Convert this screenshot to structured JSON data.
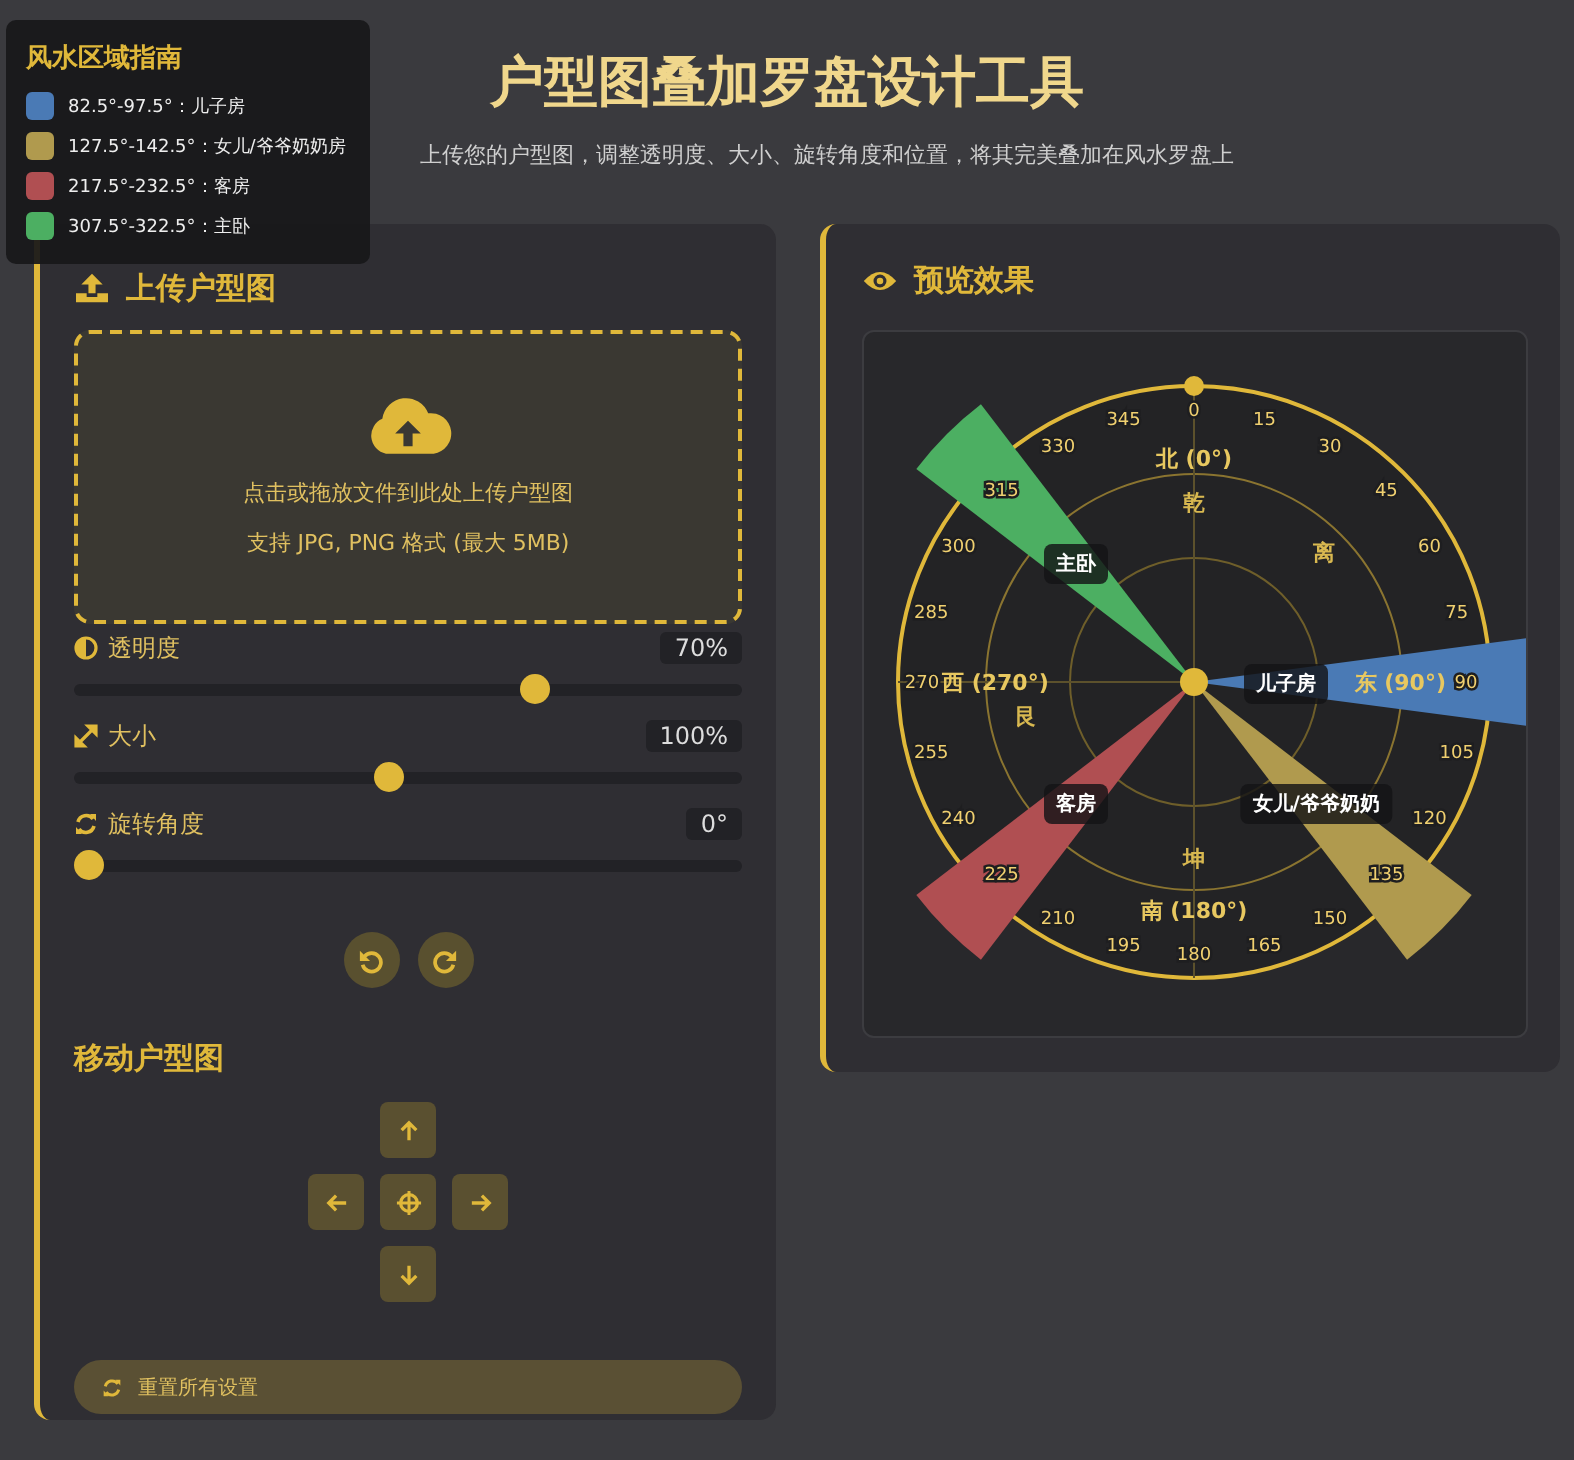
{
  "legend": {
    "title": "风水区域指南",
    "items": [
      {
        "label": "82.5°-97.5°：儿子房",
        "color": "#4a7ab5"
      },
      {
        "label": "127.5°-142.5°：女儿/爷爷奶奶房",
        "color": "#b09a4e"
      },
      {
        "label": "217.5°-232.5°：客房",
        "color": "#b04f52"
      },
      {
        "label": "307.5°-322.5°：主卧",
        "color": "#4caf62"
      }
    ]
  },
  "header": {
    "title": "户型图叠加罗盘设计工具",
    "subtitle": "上传您的户型图，调整透明度、大小、旋转角度和位置，将其完美叠加在风水罗盘上"
  },
  "upload_panel": {
    "title": "上传户型图",
    "dropzone": {
      "prompt": "点击或拖放文件到此处上传户型图",
      "hint": "支持 JPG, PNG 格式 (最大 5MB)"
    },
    "sliders": [
      {
        "kind": "opacity",
        "label": "透明度",
        "reading": "70%",
        "level": 0.7
      },
      {
        "kind": "size",
        "label": "大小",
        "reading": "100%",
        "level": 0.47
      },
      {
        "kind": "rotation",
        "label": "旋转角度",
        "reading": "0°",
        "level": 0
      }
    ],
    "move_title": "移动户型图",
    "reset_button": "重置所有设置"
  },
  "preview_panel": {
    "title": "预览效果",
    "compass": {
      "degree_labels": [
        "0",
        "15",
        "30",
        "45",
        "60",
        "75",
        "90",
        "105",
        "120",
        "135",
        "150",
        "165",
        "180",
        "195",
        "210",
        "225",
        "240",
        "255",
        "270",
        "285",
        "300",
        "315",
        "330",
        "345"
      ],
      "directions": [
        "北 (0°)",
        "东 (90°)",
        "南 (180°)",
        "西 (270°)"
      ],
      "trigrams": [
        "乾",
        "离",
        "坤",
        "艮"
      ],
      "rooms": [
        {
          "label": "主卧",
          "color": "#4caf62"
        },
        {
          "label": "儿子房",
          "color": "#4a7ab5"
        },
        {
          "label": "客房",
          "color": "#b04f52"
        },
        {
          "label": "女儿/爷爷奶奶",
          "color": "#b09a4e"
        }
      ]
    }
  }
}
